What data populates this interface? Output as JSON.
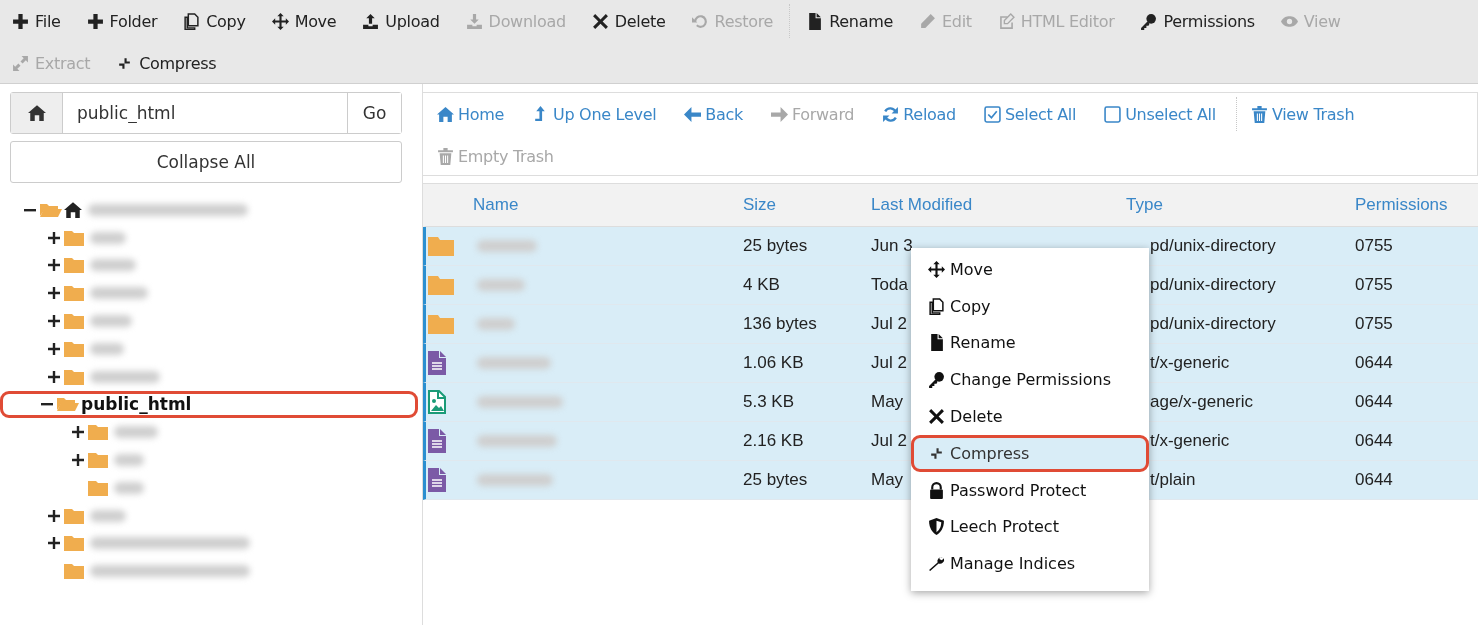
{
  "toolbar": [
    {
      "label": "File",
      "disabled": false
    },
    {
      "label": "Folder",
      "disabled": false
    },
    {
      "label": "Copy",
      "disabled": false
    },
    {
      "label": "Move",
      "disabled": false
    },
    {
      "label": "Upload",
      "disabled": false
    },
    {
      "label": "Download",
      "disabled": true
    },
    {
      "label": "Delete",
      "disabled": false
    },
    {
      "label": "Restore",
      "disabled": true
    },
    {
      "label": "Rename",
      "disabled": false,
      "separator_before": true
    },
    {
      "label": "Edit",
      "disabled": true
    },
    {
      "label": "HTML Editor",
      "disabled": true
    },
    {
      "label": "Permissions",
      "disabled": false
    },
    {
      "label": "View",
      "disabled": true
    },
    {
      "label": "Extract",
      "disabled": true
    },
    {
      "label": "Compress",
      "disabled": false
    }
  ],
  "path_bar": {
    "value": "public_html",
    "go": "Go"
  },
  "collapse_button": "Collapse All",
  "tree": [
    {
      "kind": "home",
      "expanded": true,
      "children": [
        {
          "kind": "folder",
          "expanded": false
        },
        {
          "kind": "folder",
          "expanded": false
        },
        {
          "kind": "folder",
          "expanded": false
        },
        {
          "kind": "folder",
          "expanded": false
        },
        {
          "kind": "folder",
          "expanded": false
        },
        {
          "kind": "folder",
          "expanded": false
        },
        {
          "kind": "folder",
          "label": "public_html",
          "expanded": true,
          "highlighted": true,
          "children": [
            {
              "kind": "folder",
              "expanded": false
            },
            {
              "kind": "folder",
              "expanded": false
            },
            {
              "kind": "folder"
            }
          ]
        },
        {
          "kind": "folder",
          "expanded": false
        },
        {
          "kind": "folder",
          "expanded": false
        },
        {
          "kind": "folder"
        }
      ]
    }
  ],
  "nav": [
    {
      "label": "Home",
      "disabled": false
    },
    {
      "label": "Up One Level",
      "disabled": false
    },
    {
      "label": "Back",
      "disabled": false
    },
    {
      "label": "Forward",
      "disabled": true
    },
    {
      "label": "Reload",
      "disabled": false
    },
    {
      "label": "Select All",
      "disabled": false
    },
    {
      "label": "Unselect All",
      "disabled": false
    },
    {
      "label": "View Trash",
      "disabled": false,
      "separator_before": true
    },
    {
      "label": "Empty Trash",
      "disabled": true
    }
  ],
  "table": {
    "columns": [
      "Name",
      "Size",
      "Last Modified",
      "Type",
      "Permissions"
    ],
    "rows": [
      {
        "kind": "folder",
        "selected": true,
        "size": "25 bytes",
        "modified": "Jun 3",
        "type": "pd/unix-directory",
        "type_cut": true,
        "permissions": "0755"
      },
      {
        "kind": "folder",
        "selected": true,
        "size": "4 KB",
        "modified": "Toda",
        "type": "pd/unix-directory",
        "type_cut": true,
        "permissions": "0755"
      },
      {
        "kind": "folder",
        "selected": true,
        "size": "136 bytes",
        "modified": "Jul 2",
        "type": "pd/unix-directory",
        "type_cut": true,
        "permissions": "0755"
      },
      {
        "kind": "text",
        "selected": true,
        "size": "1.06 KB",
        "modified": "Jul 2",
        "type": "t/x-generic",
        "type_cut": true,
        "permissions": "0644"
      },
      {
        "kind": "image",
        "selected": true,
        "size": "5.3 KB",
        "modified": "May",
        "type": "age/x-generic",
        "type_cut": true,
        "permissions": "0644"
      },
      {
        "kind": "text",
        "selected": true,
        "size": "2.16 KB",
        "modified": "Jul 2",
        "type": "t/x-generic",
        "type_cut": true,
        "permissions": "0644"
      },
      {
        "kind": "text",
        "selected": true,
        "size": "25 bytes",
        "modified": "May",
        "type": "t/plain",
        "type_cut": true,
        "permissions": "0644"
      }
    ]
  },
  "context_menu": [
    {
      "label": "Move",
      "selected": false
    },
    {
      "label": "Copy",
      "selected": false
    },
    {
      "label": "Rename",
      "selected": false
    },
    {
      "label": "Change Permissions",
      "selected": false
    },
    {
      "label": "Delete",
      "selected": false
    },
    {
      "label": "Compress",
      "selected": true
    },
    {
      "label": "Password Protect",
      "selected": false
    },
    {
      "label": "Leech Protect",
      "selected": false
    },
    {
      "label": "Manage Indices",
      "selected": false
    }
  ]
}
